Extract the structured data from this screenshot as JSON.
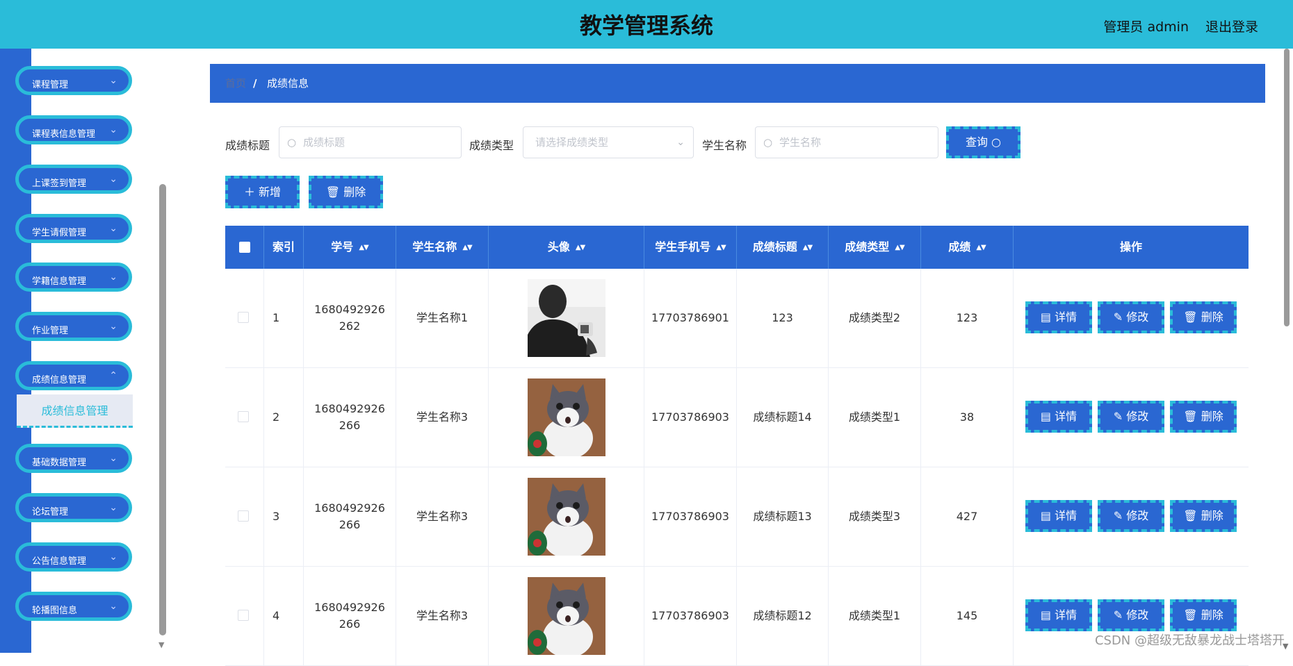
{
  "header": {
    "title": "教学管理系统",
    "user": "管理员 admin",
    "logout": "退出登录"
  },
  "sidebar": {
    "items": [
      {
        "label": "课程管理"
      },
      {
        "label": "课程表信息管理"
      },
      {
        "label": "上课签到管理"
      },
      {
        "label": "学生请假管理"
      },
      {
        "label": "学籍信息管理"
      },
      {
        "label": "作业管理"
      },
      {
        "label": "成绩信息管理"
      },
      {
        "label": "基础数据管理"
      },
      {
        "label": "论坛管理"
      },
      {
        "label": "公告信息管理"
      },
      {
        "label": "轮播图信息"
      }
    ],
    "active_sub": "成绩信息管理"
  },
  "breadcrumb": {
    "home": "首页",
    "separator": "/",
    "current": "成绩信息"
  },
  "filters": {
    "title_label": "成绩标题",
    "title_placeholder": "成绩标题",
    "type_label": "成绩类型",
    "type_placeholder": "请选择成绩类型",
    "student_label": "学生名称",
    "student_placeholder": "学生名称",
    "query_button": "查询 ○"
  },
  "actions": {
    "add": "＋ 新增",
    "delete": "🗑 删除"
  },
  "table": {
    "columns": [
      "索引",
      "学号",
      "学生名称",
      "头像",
      "学生手机号",
      "成绩标题",
      "成绩类型",
      "成绩",
      "操作"
    ],
    "rows": [
      {
        "index": "1",
        "student_no": "1680492926262",
        "student_name": "学生名称1",
        "avatar": "man-photo",
        "phone": "17703786901",
        "score_title": "123",
        "score_type": "成绩类型2",
        "score": "123"
      },
      {
        "index": "2",
        "student_no": "1680492926266",
        "student_name": "学生名称3",
        "avatar": "cat-photo",
        "phone": "17703786903",
        "score_title": "成绩标题14",
        "score_type": "成绩类型1",
        "score": "38"
      },
      {
        "index": "3",
        "student_no": "1680492926266",
        "student_name": "学生名称3",
        "avatar": "cat-photo",
        "phone": "17703786903",
        "score_title": "成绩标题13",
        "score_type": "成绩类型3",
        "score": "427"
      },
      {
        "index": "4",
        "student_no": "1680492926266",
        "student_name": "学生名称3",
        "avatar": "cat-photo",
        "phone": "17703786903",
        "score_title": "成绩标题12",
        "score_type": "成绩类型1",
        "score": "145"
      }
    ],
    "row_actions": {
      "detail": "▤ 详情",
      "edit": "✎ 修改",
      "delete": "🗑 删除"
    }
  },
  "watermark": "CSDN @超级无敌暴龙战士塔塔开",
  "colors": {
    "header": "#2abcd9",
    "primary": "#2a67d2",
    "accent_dashed": "#2abcd9"
  }
}
